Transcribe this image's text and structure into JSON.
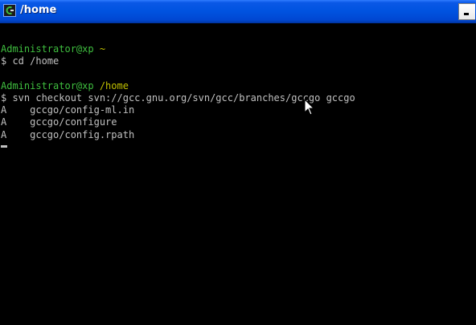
{
  "window": {
    "title": "/home",
    "icon": "cygwin-terminal-icon",
    "controls": [
      "minimize"
    ]
  },
  "colors": {
    "prompt_user": "#3fbf3f",
    "prompt_path": "#c0c000",
    "text": "#c0c0c0",
    "background": "#000000",
    "titlebar": "#0053e0"
  },
  "terminal": {
    "block1": {
      "prompt_user": "Administrator@xp",
      "prompt_path": "~",
      "command": "$ cd /home"
    },
    "block2": {
      "prompt_user": "Administrator@xp",
      "prompt_path": "/home",
      "command": "$ svn checkout svn://gcc.gnu.org/svn/gcc/branches/gccgo gccgo",
      "output": [
        "A    gccgo/config-ml.in",
        "A    gccgo/configure",
        "A    gccgo/config.rpath"
      ]
    }
  }
}
